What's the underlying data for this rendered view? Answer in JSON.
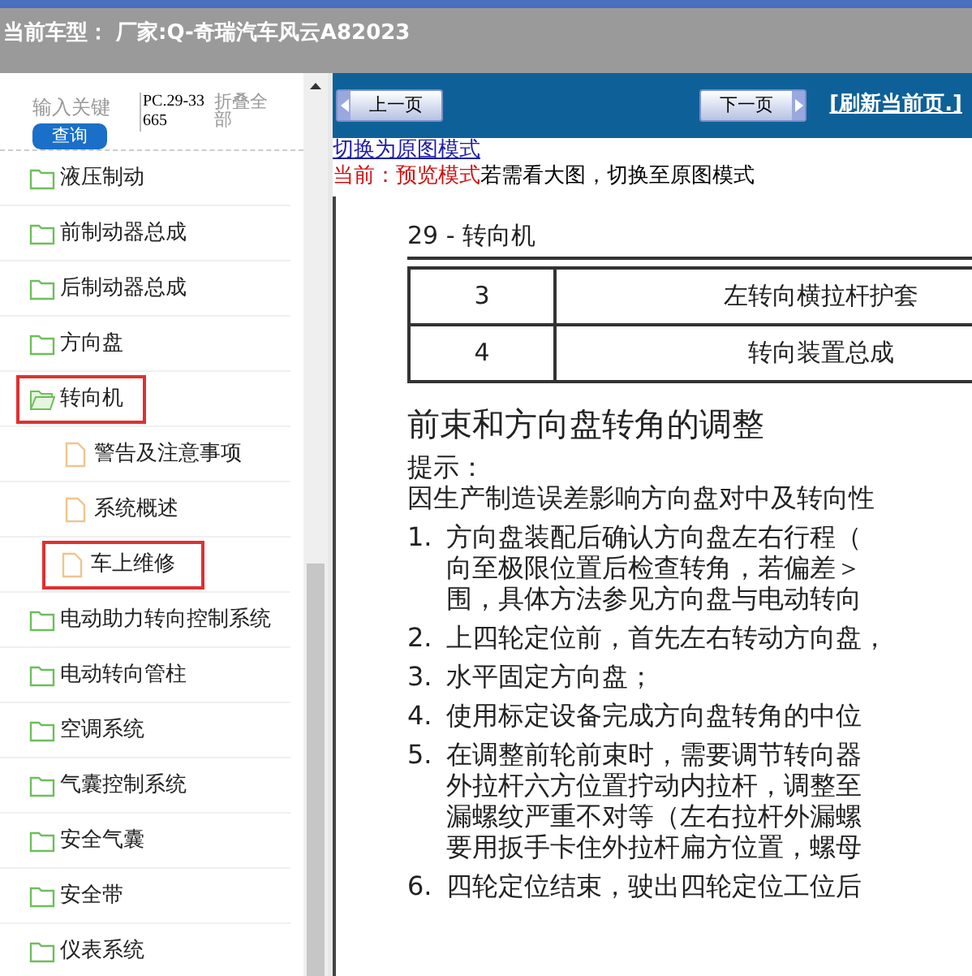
{
  "header": {
    "title": "当前车型： 厂家:Q-奇瑞汽车风云A82023"
  },
  "sidebar": {
    "search": {
      "placeholder": "输入关键"
    },
    "search_button": "查询",
    "code": "PC.29-33665",
    "collapse_link": "折叠全部",
    "items": [
      {
        "label": "液压制动",
        "expanded": false,
        "highlighted": false
      },
      {
        "label": "前制动器总成",
        "expanded": false,
        "highlighted": false
      },
      {
        "label": "后制动器总成",
        "expanded": false,
        "highlighted": false
      },
      {
        "label": "方向盘",
        "expanded": false,
        "highlighted": false
      },
      {
        "label": "转向机",
        "expanded": true,
        "highlighted": true,
        "children": [
          {
            "label": "警告及注意事项",
            "highlighted": false
          },
          {
            "label": "系统概述",
            "highlighted": false
          },
          {
            "label": "车上维修",
            "highlighted": true
          }
        ]
      },
      {
        "label": "电动助力转向控制系统",
        "expanded": false,
        "highlighted": false
      },
      {
        "label": "电动转向管柱",
        "expanded": false,
        "highlighted": false
      },
      {
        "label": "空调系统",
        "expanded": false,
        "highlighted": false
      },
      {
        "label": "气囊控制系统",
        "expanded": false,
        "highlighted": false
      },
      {
        "label": "安全气囊",
        "expanded": false,
        "highlighted": false
      },
      {
        "label": "安全带",
        "expanded": false,
        "highlighted": false
      },
      {
        "label": "仪表系统",
        "expanded": false,
        "highlighted": false
      }
    ]
  },
  "toolbar": {
    "prev": "上一页",
    "next": "下一页",
    "refresh": "[刷新当前页.]"
  },
  "mode_link": "切换为原图模式",
  "mode_status": {
    "current": "当前：预览模式",
    "hint": "若需看大图，切换至原图模式"
  },
  "document": {
    "section": "29 - 转向机",
    "table": {
      "rows": [
        [
          "3",
          "左转向横拉杆护套"
        ],
        [
          "4",
          "转向装置总成"
        ]
      ]
    },
    "heading": "前束和方向盘转角的调整",
    "tip_label": "提示：",
    "intro": "因生产制造误差影响方向盘对中及转向性",
    "steps": [
      {
        "number": "1.",
        "lines": [
          "方向盘装配后确认方向盘左右行程（",
          "向至极限位置后检查转角，若偏差＞",
          "围，具体方法参见方向盘与电动转向"
        ]
      },
      {
        "number": "2.",
        "lines": [
          "上四轮定位前，首先左右转动方向盘，"
        ]
      },
      {
        "number": "3.",
        "lines": [
          "水平固定方向盘；"
        ]
      },
      {
        "number": "4.",
        "lines": [
          "使用标定设备完成方向盘转角的中位"
        ]
      },
      {
        "number": "5.",
        "lines": [
          "在调整前轮前束时，需要调节转向器",
          "外拉杆六方位置拧动内拉杆，调整至",
          "漏螺纹严重不对等（左右拉杆外漏螺",
          "要用扳手卡住外拉杆扁方位置，螺母"
        ]
      },
      {
        "number": "6.",
        "lines": [
          "四轮定位结束，驶出四轮定位工位后"
        ]
      }
    ]
  }
}
